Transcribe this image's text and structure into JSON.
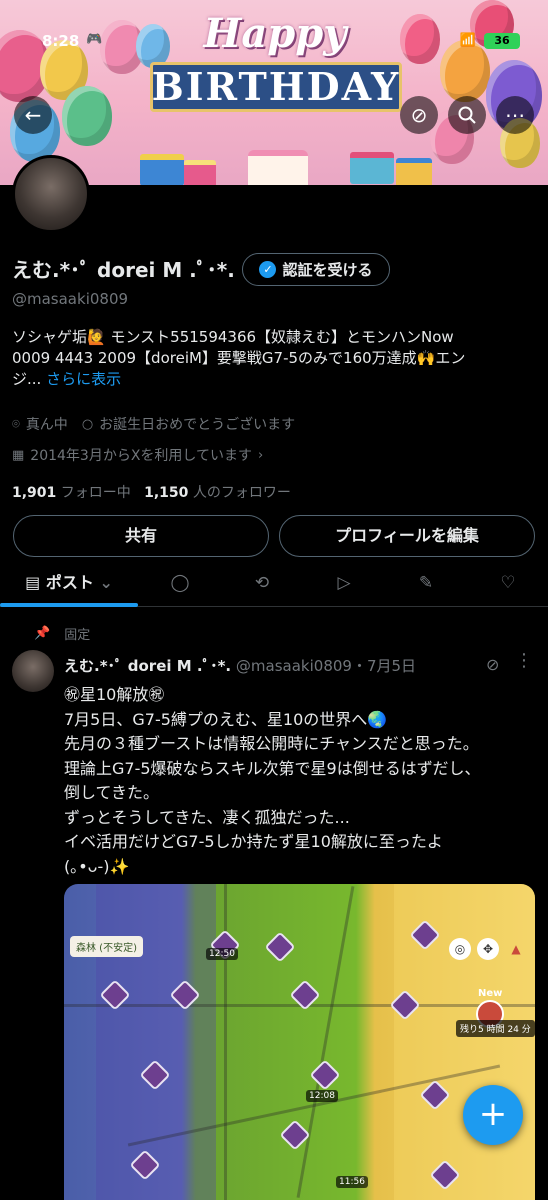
{
  "status_bar": {
    "time": "8:28",
    "battery": "36"
  },
  "banner": {
    "happy": "Happy",
    "birthday": "BIRTHDAY"
  },
  "profile": {
    "display_name": "えむ.*･ﾟ dorei M .ﾟ･*.",
    "verify_label": "認証を受ける",
    "handle": "@masaaki0809",
    "bio_lines": [
      "ソシャゲ垢🙋 モンスト551594366【奴隷えむ】とモンハンNow",
      "0009 4443 2009【doreiM】要撃戦G7-5のみで160万達成🙌エン"
    ],
    "bio_tail": "ジ...",
    "bio_more": "さらに表示",
    "location": "真ん中",
    "birthday_text": "お誕生日おめでとうございます",
    "joined": "2014年3月からXを利用しています",
    "following_count": "1,901",
    "following_label": "フォロー中",
    "followers_count": "1,150",
    "followers_label": "人のフォロワー",
    "share_label": "共有",
    "edit_label": "プロフィールを編集"
  },
  "tabs": {
    "posts_label": "ポスト"
  },
  "pinned_post": {
    "pinned_label": "固定",
    "author_name": "えむ.*･ﾟ dorei M .ﾟ･*.",
    "author_sub": "@masaaki0809・7月5日",
    "lines": [
      "㊗星10解放㊗",
      "7月5日、G7-5縛プのえむ、星10の世界へ🌏",
      "先月の３種ブーストは情報公開時にチャンスだと思った。",
      "理論上G7-5爆破ならスキル次第で星9は倒せるはずだし、",
      "倒してきた。",
      "ずっとそうしてきた、凄く孤独だった...",
      "イベ活用だけどG7-5しか持たず星10解放に至ったよ",
      "(｡•ᴗ-)✨"
    ],
    "map": {
      "area_chip": "森林 (不安定)",
      "timer_1": "12:50",
      "timer_2": "12:08",
      "timer_3": "11:56",
      "new_label": "New",
      "remaining": "残り5 時間 24 分"
    }
  },
  "fab_label": "+"
}
